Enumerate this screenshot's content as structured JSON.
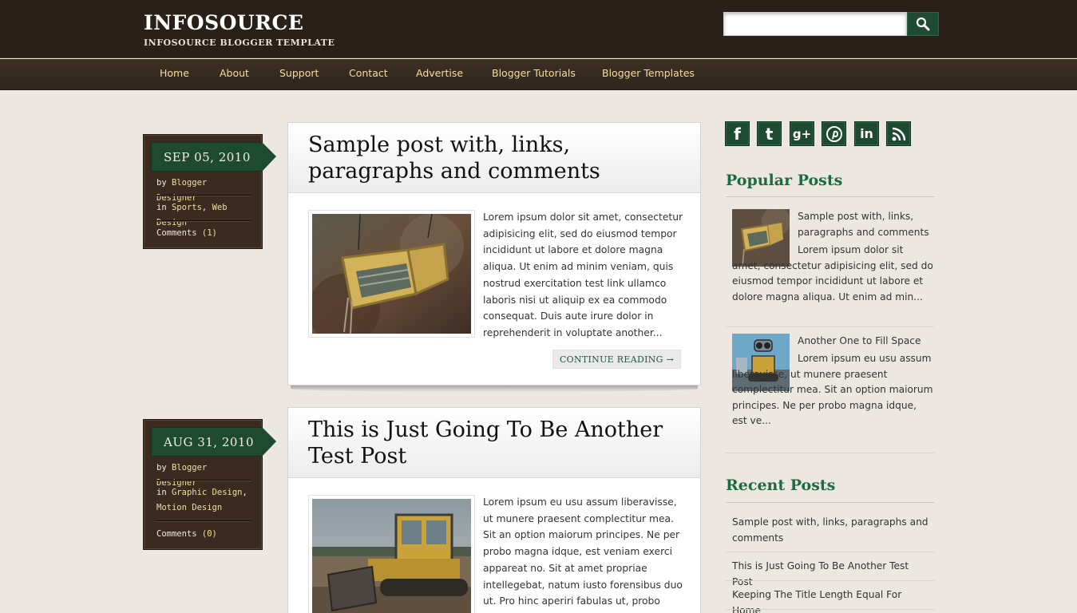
{
  "header": {
    "title": "INFOSOURCE",
    "subtitle": "INFOSOURCE BLOGGER TEMPLATE",
    "search": {
      "value": "",
      "placeholder": ""
    }
  },
  "nav": {
    "items": [
      {
        "label": "Home"
      },
      {
        "label": "About"
      },
      {
        "label": "Support"
      },
      {
        "label": "Contact"
      },
      {
        "label": "Advertise"
      },
      {
        "label": "Blogger Tutorials"
      },
      {
        "label": "Blogger Templates"
      }
    ]
  },
  "posts": [
    {
      "date": "SEP 05, 2010",
      "by_prefix": "by",
      "author": "Blogger Designer",
      "in_prefix": "in",
      "categories": [
        "Sports",
        "Web Design"
      ],
      "sep": ",",
      "comments_prefix": "Comments",
      "comments_count": "(1)",
      "title": "Sample post with, links, paragraphs and comments",
      "excerpt": "Lorem ipsum dolor sit amet, consectetur adipisicing elit, sed do eiusmod tempor incididunt ut labore et dolore magna aliqua. Ut enim ad minim veniam, quis nostrud exercitation test link ullamco laboris nisi ut aliquip ex ea commodo consequat. Duis aute irure dolor in reprehenderit in voluptate another...",
      "continue_label": "CONTINUE READING →"
    },
    {
      "date": "AUG 31, 2010",
      "by_prefix": "by",
      "author": "Blogger Designer",
      "in_prefix": "in",
      "categories": [
        "Graphic Design",
        "Motion Design"
      ],
      "sep": ",",
      "comments_prefix": "Comments",
      "comments_count": "(0)",
      "title": "This is Just Going To Be Another Test Post",
      "excerpt": "Lorem ipsum eu usu assum liberavisse, ut munere praesent complectitur mea. Sit an option maiorum principes. Ne per probo magna idque, est veniam exerci appareat no. Sit at amet propriae intellegebat, natum iusto forensibus duo ut. Pro hinc aperiri fabulas ut, probo tractatos"
    }
  ],
  "sidebar": {
    "social": [
      {
        "icon": "facebook-icon"
      },
      {
        "icon": "twitter-icon"
      },
      {
        "icon": "google-plus-icon"
      },
      {
        "icon": "pinterest-icon"
      },
      {
        "icon": "linkedin-icon"
      },
      {
        "icon": "rss-icon"
      }
    ],
    "popular_title": "Popular Posts",
    "popular": [
      {
        "title": "Sample post with, links, paragraphs and comments",
        "snippet": "Lorem ipsum dolor sit amet, consectetur adipisicing elit, sed do eiusmod tempor incididunt ut labore et dolore magna aliqua. Ut enim ad min..."
      },
      {
        "title": "Another One to Fill Space",
        "snippet": "Lorem ipsum eu usu assum liberavisse, ut munere praesent complectitur mea. Sit an option maiorum principes. Ne per probo magna idque, est ve..."
      }
    ],
    "recent_title": "Recent Posts",
    "recent": [
      {
        "title": "Sample post with, links, paragraphs and comments"
      },
      {
        "title": "This is Just Going To Be Another Test Post"
      },
      {
        "title": "Keeping The Title Length Equal For Home"
      }
    ]
  },
  "colors": {
    "header_bg": "#2a1f19",
    "nav_text": "#f4df9c",
    "accent_green": "#1d4a30",
    "widget_title": "#1d6b43",
    "page_bg": "#ece8e1"
  }
}
